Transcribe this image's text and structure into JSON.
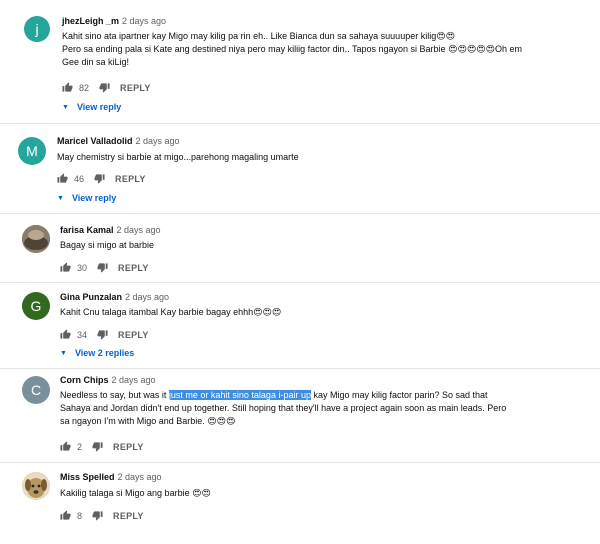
{
  "comments": [
    {
      "initial": "j",
      "avatar_color": "#26a69a",
      "author": "jhezLeigh _m",
      "time": "2 days ago",
      "lines": [
        "Kahit sino ata ipartner kay Migo may kilig pa rin eh.. Like Bianca dun sa sahaya suuuuper kilig😍😍",
        "Pero sa ending pala si Kate ang destined niya pero may kiliig factor din.. Tapos ngayon si Barbie 😍😍😍😍😍Oh em",
        "Gee din sa kiLig!"
      ],
      "likes": "82",
      "reply": "REPLY",
      "view": "View reply"
    },
    {
      "initial": "M",
      "avatar_color": "#26a69a",
      "author": "Maricel Valladolid",
      "time": "2 days ago",
      "lines": [
        "May chemistry si barbie at migo...parehong magaling umarte"
      ],
      "likes": "46",
      "reply": "REPLY",
      "view": "View reply"
    },
    {
      "initial": "",
      "avatar_color": "#6b6258",
      "author": "farisa Kamal",
      "time": "2 days ago",
      "lines": [
        "Bagay si migo at barbie"
      ],
      "likes": "30",
      "reply": "REPLY"
    },
    {
      "initial": "G",
      "avatar_color": "#33691e",
      "author": "Gina Punzalan",
      "time": "2 days ago",
      "lines": [
        "Kahit Cnu talaga itambal Kay barbie bagay ehhh😍😍😍"
      ],
      "likes": "34",
      "reply": "REPLY",
      "view": "View 2 replies"
    },
    {
      "initial": "C",
      "avatar_color": "#78909c",
      "author": "Corn Chips",
      "time": "2 days ago",
      "line1_pre": "Needless to say, but was it ",
      "line1_hl": "just me or kahit sino talaga i-pair up",
      "line1_post": " kay Migo may kilig factor parin? So sad that",
      "lines_rest": [
        "Sahaya and Jordan didn't end up together. Still hoping that they'll have a project again soon as main leads. Pero",
        "sa ngayon I'm with Migo and Barbie. 😍😍😍"
      ],
      "likes": "2",
      "reply": "REPLY"
    },
    {
      "initial": "",
      "avatar_color": "#c9b58c",
      "author": "Miss Spelled",
      "time": "2 days ago",
      "lines": [
        "Kakilig talaga si Migo ang barbie 😍😍"
      ],
      "likes": "8",
      "reply": "REPLY"
    }
  ]
}
